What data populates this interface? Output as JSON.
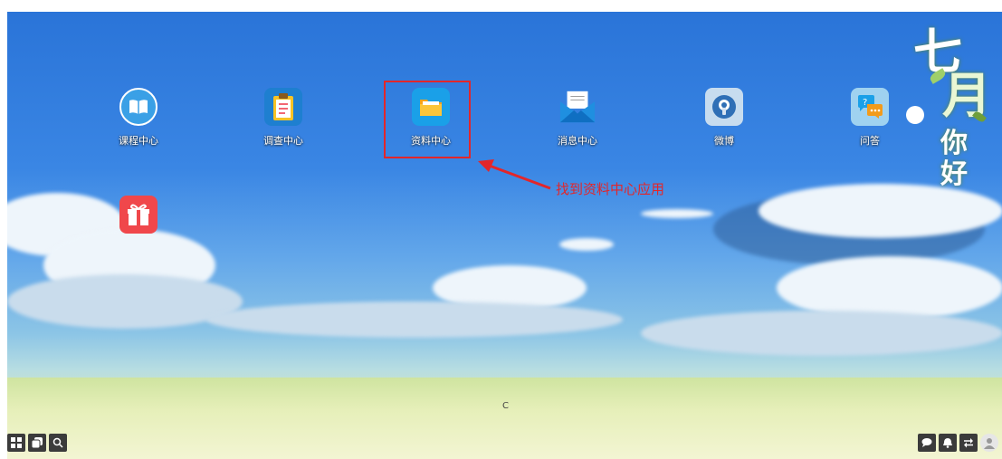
{
  "desktop": {
    "apps": [
      {
        "id": "course",
        "label": "课程中心",
        "icon": "book-icon"
      },
      {
        "id": "survey",
        "label": "调查中心",
        "icon": "clipboard-icon"
      },
      {
        "id": "resource",
        "label": "资料中心",
        "icon": "folder-icon"
      },
      {
        "id": "message",
        "label": "消息中心",
        "icon": "mail-icon"
      },
      {
        "id": "weibo",
        "label": "微博",
        "icon": "microphone-icon"
      },
      {
        "id": "qa",
        "label": "问答",
        "icon": "question-chat-icon"
      },
      {
        "id": "gift",
        "label": "",
        "icon": "gift-icon"
      }
    ],
    "annotation": "找到资料中心应用",
    "corner_char": "C"
  },
  "decoration": {
    "line1": "七",
    "line2": "月",
    "line3": "你",
    "line4": "好"
  },
  "taskbar": {
    "left": [
      "apps-grid-icon",
      "windows-icon",
      "search-icon"
    ],
    "right": [
      "chat-icon",
      "bell-icon",
      "switch-icon",
      "user-avatar-icon"
    ]
  },
  "colors": {
    "highlight": "#e3262a",
    "taskbar": "#3b3b3b"
  }
}
